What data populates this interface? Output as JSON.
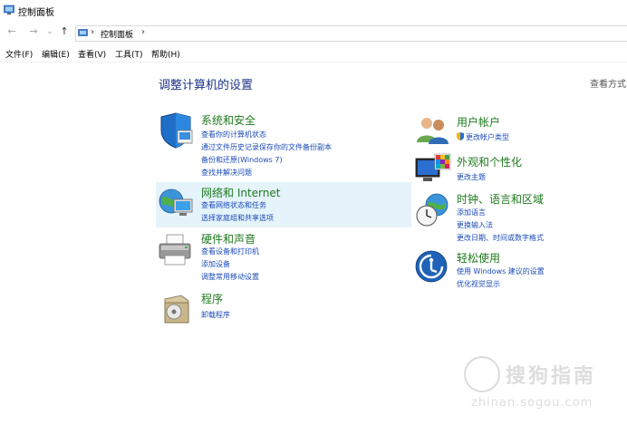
{
  "window": {
    "title": "控制面板"
  },
  "address": {
    "back": "←",
    "forward": "→",
    "recent": "⌄",
    "up": "↑",
    "separator": "›",
    "crumb": "控制面板",
    "crumb_arrow": "›"
  },
  "menu": [
    "文件(F)",
    "编辑(E)",
    "查看(V)",
    "工具(T)",
    "帮助(H)"
  ],
  "main": {
    "heading": "调整计算机的设置",
    "view_by": "查看方式",
    "categories": [
      {
        "title": "系统和安全",
        "icon": "shield-icon",
        "links": [
          "查看你的计算机状态",
          "通过文件历史记录保存你的文件备份副本",
          "备份和还原(Windows 7)",
          "查找并解决问题"
        ]
      },
      {
        "title": "网络和 Internet",
        "icon": "network-globe-icon",
        "highlighted": true,
        "links": [
          "查看网络状态和任务",
          "选择家庭组和共享选项"
        ]
      },
      {
        "title": "硬件和声音",
        "icon": "printer-icon",
        "links": [
          "查看设备和打印机",
          "添加设备",
          "调整常用移动设置"
        ]
      },
      {
        "title": "程序",
        "icon": "programs-disc-icon",
        "links": [
          "卸载程序"
        ]
      },
      {
        "title": "用户帐户",
        "icon": "users-icon",
        "links": [
          "更改帐户类型"
        ]
      },
      {
        "title": "外观和个性化",
        "icon": "monitor-palette-icon",
        "links": [
          "更改主题"
        ]
      },
      {
        "title": "时钟、语言和区域",
        "icon": "clock-globe-icon",
        "links": [
          "添加语言",
          "更换输入法",
          "更改日期、时间或数字格式"
        ]
      },
      {
        "title": "轻松使用",
        "icon": "ease-of-access-icon",
        "links": [
          "使用 Windows 建议的设置",
          "优化视觉显示"
        ]
      }
    ]
  },
  "watermark": {
    "brand": "搜狗指南",
    "url": "zhinan.sogou.com"
  }
}
